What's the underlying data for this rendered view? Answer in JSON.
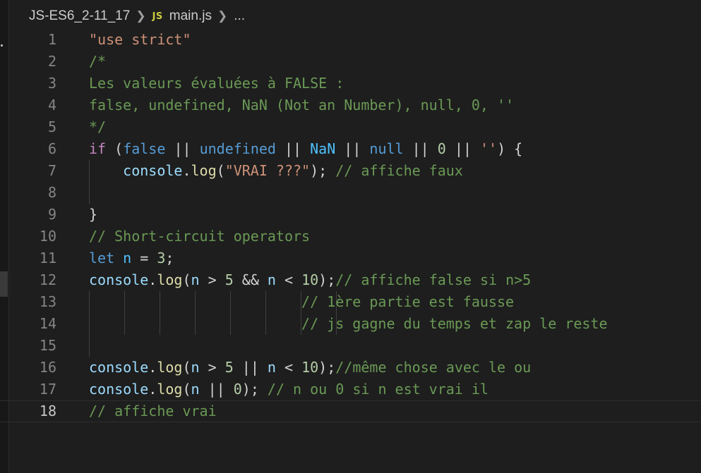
{
  "breadcrumb": {
    "folder": "JS-ES6_2-11_17",
    "file_icon": "JS",
    "file": "main.js",
    "more": "..."
  },
  "editor": {
    "current_line": 18,
    "lines": [
      {
        "n": "1",
        "tokens": [
          {
            "t": "\"use strict\"",
            "c": "str"
          }
        ]
      },
      {
        "n": "2",
        "tokens": [
          {
            "t": "/*",
            "c": "com"
          }
        ]
      },
      {
        "n": "3",
        "tokens": [
          {
            "t": "Les valeurs évaluées à FALSE :",
            "c": "com"
          }
        ]
      },
      {
        "n": "4",
        "tokens": [
          {
            "t": "false, undefined, NaN (Not an Number), null, 0, ''",
            "c": "com"
          }
        ]
      },
      {
        "n": "5",
        "tokens": [
          {
            "t": "*/",
            "c": "com"
          }
        ]
      },
      {
        "n": "6",
        "tokens": [
          {
            "t": "if",
            "c": "ctl"
          },
          {
            "t": " (",
            "c": "pun"
          },
          {
            "t": "false",
            "c": "kw"
          },
          {
            "t": " || ",
            "c": "pun"
          },
          {
            "t": "undefined",
            "c": "kw"
          },
          {
            "t": " || ",
            "c": "pun"
          },
          {
            "t": "NaN",
            "c": "const"
          },
          {
            "t": " || ",
            "c": "pun"
          },
          {
            "t": "null",
            "c": "kw"
          },
          {
            "t": " || ",
            "c": "pun"
          },
          {
            "t": "0",
            "c": "num"
          },
          {
            "t": " || ",
            "c": "pun"
          },
          {
            "t": "''",
            "c": "str"
          },
          {
            "t": ") {",
            "c": "pun"
          }
        ]
      },
      {
        "n": "7",
        "tokens": [
          {
            "t": "    ",
            "c": "pun"
          },
          {
            "t": "console",
            "c": "var"
          },
          {
            "t": ".",
            "c": "pun"
          },
          {
            "t": "log",
            "c": "fn"
          },
          {
            "t": "(",
            "c": "pun"
          },
          {
            "t": "\"VRAI ???\"",
            "c": "str"
          },
          {
            "t": "); ",
            "c": "pun"
          },
          {
            "t": "// affiche faux",
            "c": "com"
          }
        ]
      },
      {
        "n": "8",
        "tokens": []
      },
      {
        "n": "9",
        "tokens": [
          {
            "t": "}",
            "c": "pun"
          }
        ]
      },
      {
        "n": "10",
        "tokens": [
          {
            "t": "// Short-circuit operators",
            "c": "com"
          }
        ]
      },
      {
        "n": "11",
        "tokens": [
          {
            "t": "let",
            "c": "kw"
          },
          {
            "t": " ",
            "c": "pun"
          },
          {
            "t": "n",
            "c": "const"
          },
          {
            "t": " = ",
            "c": "pun"
          },
          {
            "t": "3",
            "c": "num"
          },
          {
            "t": ";",
            "c": "pun"
          }
        ]
      },
      {
        "n": "12",
        "tokens": [
          {
            "t": "console",
            "c": "var"
          },
          {
            "t": ".",
            "c": "pun"
          },
          {
            "t": "log",
            "c": "fn"
          },
          {
            "t": "(",
            "c": "pun"
          },
          {
            "t": "n",
            "c": "var"
          },
          {
            "t": " > ",
            "c": "pun"
          },
          {
            "t": "5",
            "c": "num"
          },
          {
            "t": " && ",
            "c": "pun"
          },
          {
            "t": "n",
            "c": "var"
          },
          {
            "t": " < ",
            "c": "pun"
          },
          {
            "t": "10",
            "c": "num"
          },
          {
            "t": ");",
            "c": "pun"
          },
          {
            "t": "// affiche false si n>5",
            "c": "com"
          }
        ]
      },
      {
        "n": "13",
        "tokens": [
          {
            "t": "                         ",
            "c": "pun"
          },
          {
            "t": "// 1ère partie est fausse",
            "c": "com"
          }
        ]
      },
      {
        "n": "14",
        "tokens": [
          {
            "t": "                         ",
            "c": "pun"
          },
          {
            "t": "// js gagne du temps et zap le reste",
            "c": "com"
          }
        ]
      },
      {
        "n": "15",
        "tokens": []
      },
      {
        "n": "16",
        "tokens": [
          {
            "t": "console",
            "c": "var"
          },
          {
            "t": ".",
            "c": "pun"
          },
          {
            "t": "log",
            "c": "fn"
          },
          {
            "t": "(",
            "c": "pun"
          },
          {
            "t": "n",
            "c": "var"
          },
          {
            "t": " > ",
            "c": "pun"
          },
          {
            "t": "5",
            "c": "num"
          },
          {
            "t": " || ",
            "c": "pun"
          },
          {
            "t": "n",
            "c": "var"
          },
          {
            "t": " < ",
            "c": "pun"
          },
          {
            "t": "10",
            "c": "num"
          },
          {
            "t": ");",
            "c": "pun"
          },
          {
            "t": "//même chose avec le ou",
            "c": "com"
          }
        ]
      },
      {
        "n": "17",
        "tokens": [
          {
            "t": "console",
            "c": "var"
          },
          {
            "t": ".",
            "c": "pun"
          },
          {
            "t": "log",
            "c": "fn"
          },
          {
            "t": "(",
            "c": "pun"
          },
          {
            "t": "n",
            "c": "var"
          },
          {
            "t": " || ",
            "c": "pun"
          },
          {
            "t": "0",
            "c": "num"
          },
          {
            "t": "); ",
            "c": "pun"
          },
          {
            "t": "// n ou 0 si n est vrai il",
            "c": "com"
          }
        ]
      },
      {
        "n": "18",
        "tokens": [
          {
            "t": "// affiche vrai",
            "c": "com"
          }
        ]
      }
    ]
  },
  "colors": {
    "background": "#1e1e1e",
    "string": "#ce9178",
    "comment": "#6a9955",
    "keyword": "#569cd6",
    "control": "#c586c0",
    "variable": "#9cdcfe",
    "constant": "#4fc1ff",
    "number": "#b5cea8",
    "function": "#dcdcaa",
    "js_icon": "#cbcb41"
  }
}
